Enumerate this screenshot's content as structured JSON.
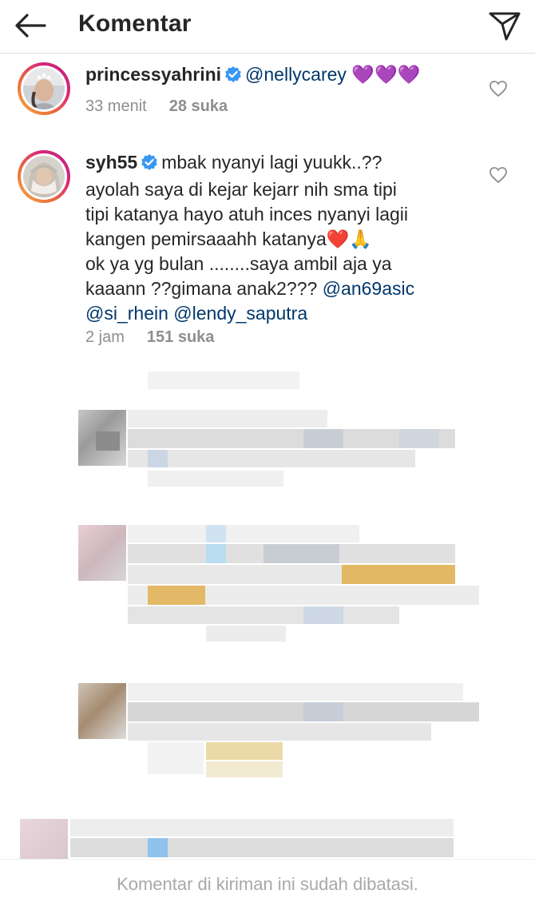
{
  "header": {
    "title": "Komentar",
    "back_icon": "arrow-left-icon",
    "send_icon": "paper-plane-icon"
  },
  "comments": [
    {
      "username": "princessyahrini",
      "verified": true,
      "text_mention": "@nellycarey",
      "emoji": "💜💜💜",
      "time": "33 menit",
      "likes": "28 suka"
    },
    {
      "username": "syh55",
      "verified": true,
      "lines": [
        "mbak nyanyi lagi yuukk..??",
        "ayolah saya di kejar kejarr nih sma tipi",
        "tipi katanya hayo atuh inces nyanyi lagii",
        "kangen pemirsaaahh katanya",
        "ok ya yg bulan ........saya ambil aja ya",
        "kaaann ??gimana anak2??? "
      ],
      "line4_emoji": "❤️🙏",
      "mentions": [
        "@an69asic",
        "@si_rhein",
        "@lendy_saputra"
      ],
      "time": "2 jam",
      "likes": "151 suka"
    }
  ],
  "footer": {
    "notice": "Komentar di kiriman ini sudah dibatasi."
  },
  "colors": {
    "text": "#262626",
    "meta": "#8e8e8e",
    "mention": "#00376b",
    "verified": "#3897f0",
    "footer_text": "#a8a8a8"
  }
}
